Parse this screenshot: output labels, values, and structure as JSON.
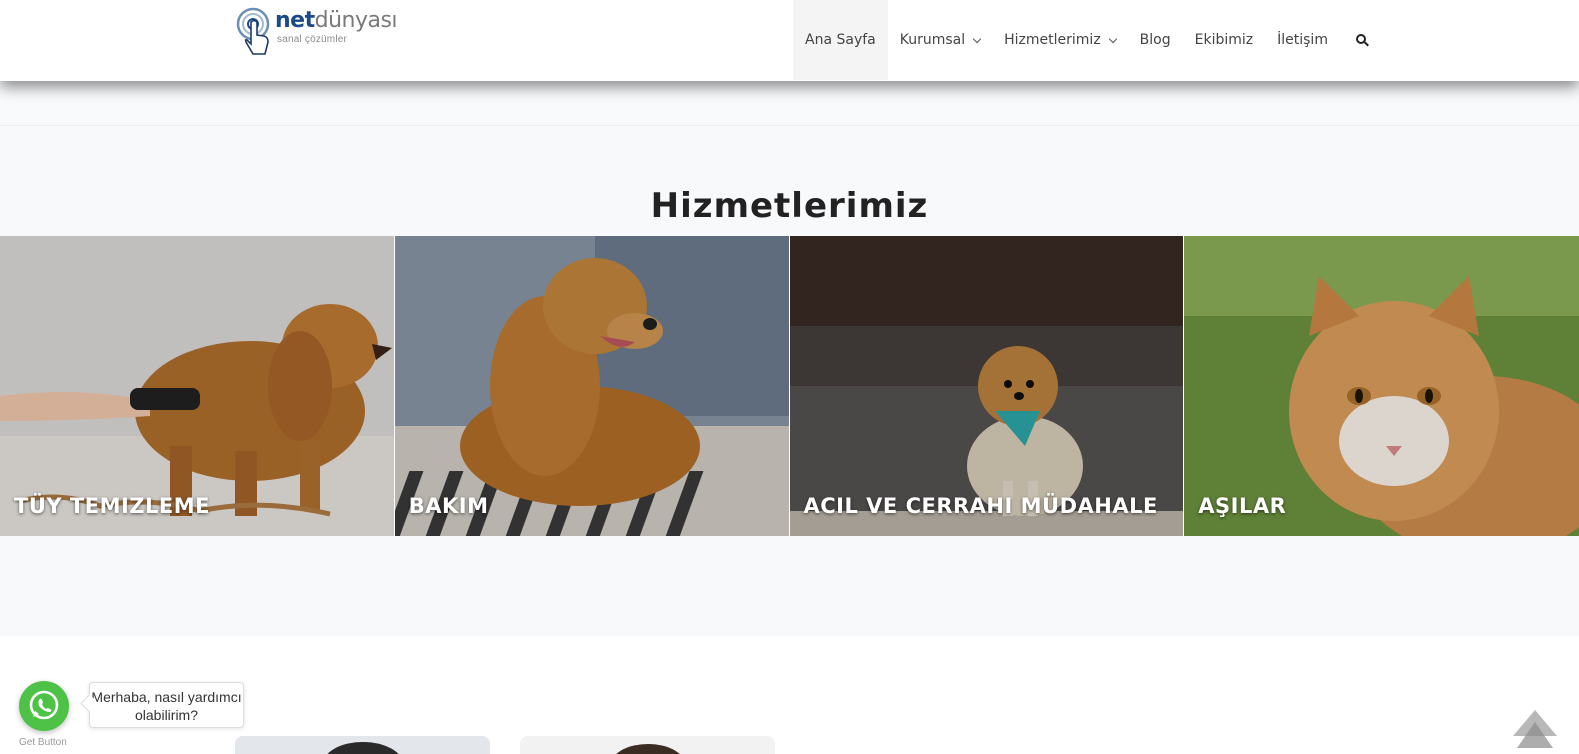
{
  "brand": {
    "logo_main_1": "net",
    "logo_main_2": "dünyası",
    "logo_sub": "sanal çözümler"
  },
  "nav": {
    "items": [
      {
        "label": "Ana Sayfa",
        "active": true,
        "dropdown": false
      },
      {
        "label": "Kurumsal",
        "active": false,
        "dropdown": true
      },
      {
        "label": "Hizmetlerimiz",
        "active": false,
        "dropdown": true
      },
      {
        "label": "Blog",
        "active": false,
        "dropdown": false
      },
      {
        "label": "Ekibimiz",
        "active": false,
        "dropdown": false
      },
      {
        "label": "İletişim",
        "active": false,
        "dropdown": false
      }
    ],
    "search_icon": "search-icon"
  },
  "services": {
    "title": "Hizmetlerimiz",
    "cards": [
      {
        "label": "TÜY TEMIZLEME",
        "image": "cocker spaniel being groomed"
      },
      {
        "label": "BAKIM",
        "image": "golden retriever lying"
      },
      {
        "label": "ACIL VE CERRAHI MÜDAHALE",
        "image": "pomeranian with bandana"
      },
      {
        "label": "AŞILAR",
        "image": "orange tabby cat on grass"
      }
    ]
  },
  "whatsapp": {
    "message": "Merhaba, nasıl yardımcı olabilirim?",
    "credit": "Get Button",
    "color": "#4dc247"
  },
  "colors": {
    "accent": "#1b4a8a",
    "card_text": "#ffffff"
  }
}
